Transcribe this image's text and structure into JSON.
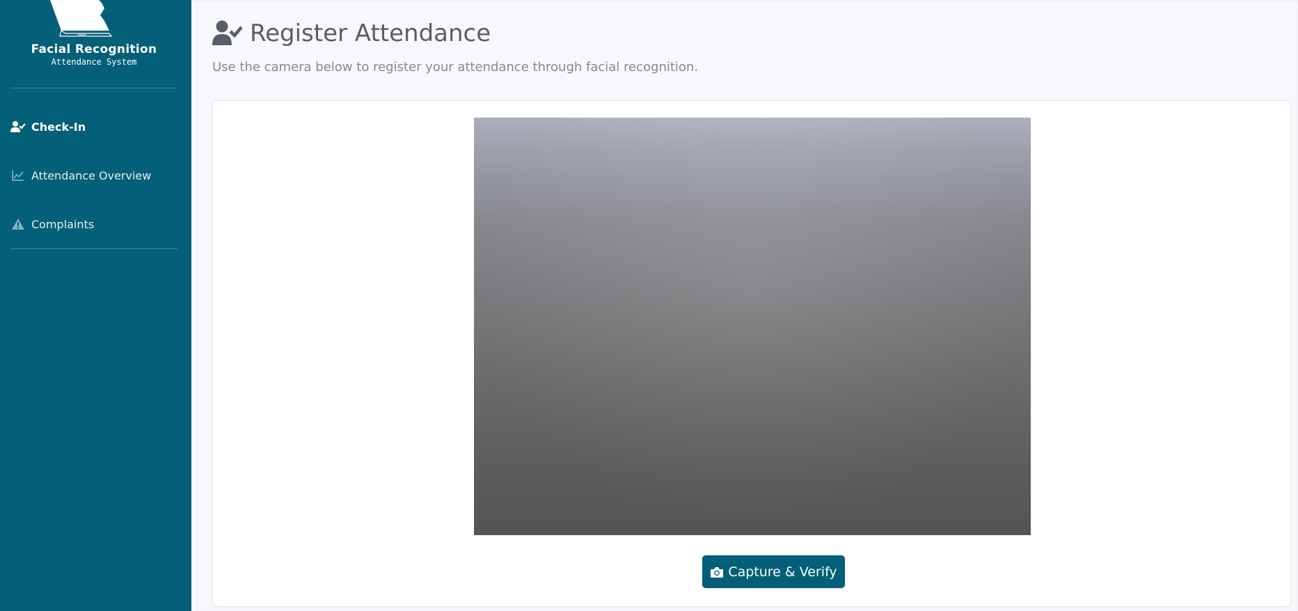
{
  "sidebar": {
    "logo_title": "Facial Recognition",
    "logo_subtitle": "Attendance System",
    "items": [
      {
        "label": "Check-In",
        "icon": "user-check-icon",
        "active": true
      },
      {
        "label": "Attendance Overview",
        "icon": "chart-line-icon",
        "active": false
      },
      {
        "label": "Complaints",
        "icon": "warning-icon",
        "active": false
      }
    ]
  },
  "header": {
    "title": "Register Attendance",
    "subtitle": "Use the camera below to register your attendance through facial recognition.",
    "icon": "user-check-icon"
  },
  "camera": {
    "icon": "camera-icon"
  },
  "capture_button": {
    "label": "Capture & Verify",
    "icon": "camera-icon"
  },
  "colors": {
    "sidebar_bg": "#045f78",
    "accent": "#045f78",
    "page_bg": "#f7f8fb",
    "title_text": "#5a5c69",
    "muted_text": "#858796"
  }
}
